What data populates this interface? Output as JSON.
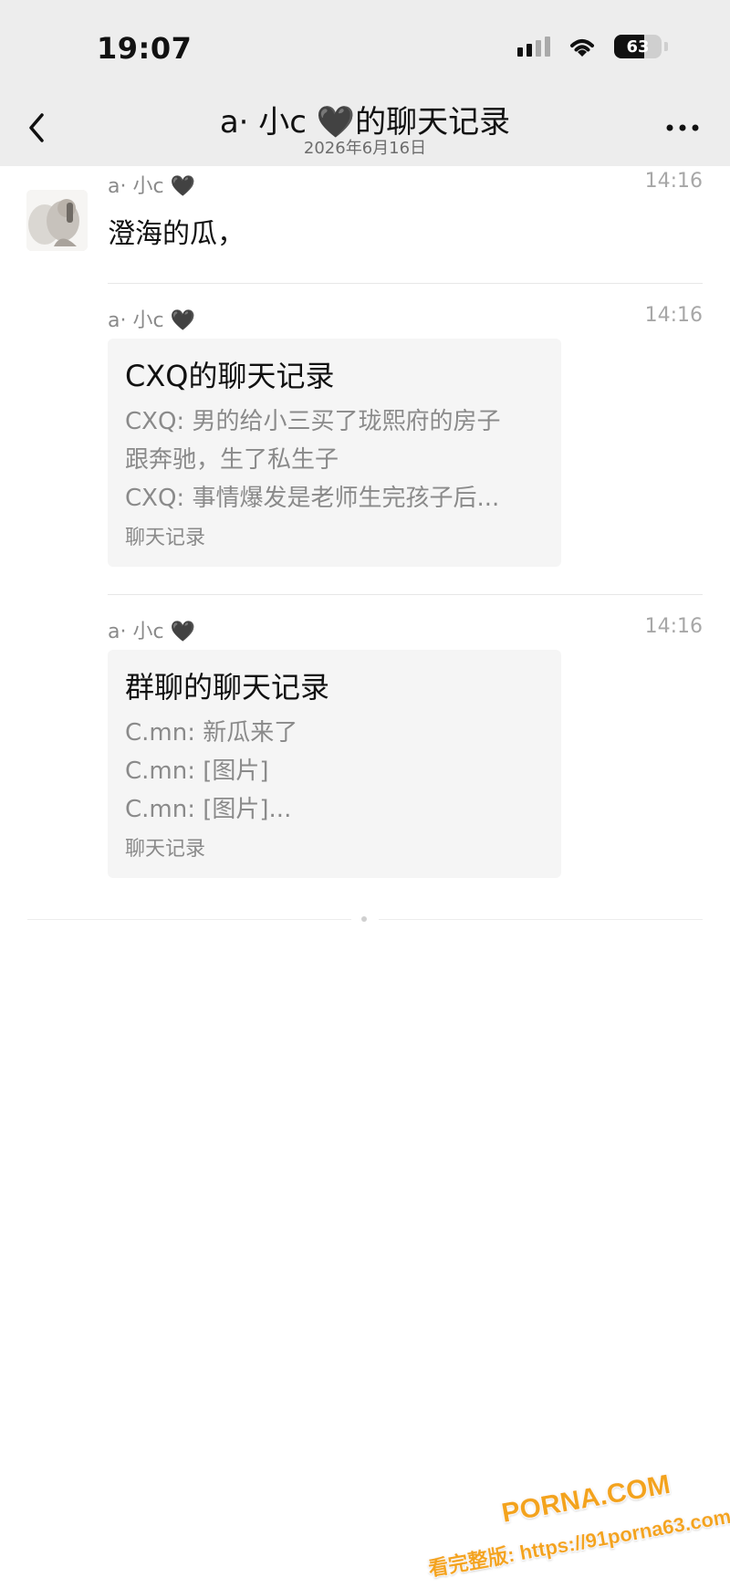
{
  "status_bar": {
    "time": "19:07",
    "battery": "63",
    "battery_level": 0.63
  },
  "nav": {
    "title": "a· 小c 🖤的聊天记录",
    "subtitle": "2026年6月16日"
  },
  "messages": [
    {
      "sender": "a· 小c 🖤",
      "time": "14:16",
      "text": "澄海的瓜，"
    },
    {
      "sender": "a· 小c 🖤",
      "time": "14:16",
      "card": {
        "title": "CXQ的聊天记录",
        "lines": [
          "CXQ: 男的给小三买了珑熙府的房子",
          "跟奔驰，生了私生子",
          "CXQ: 事情爆发是老师生完孩子后..."
        ],
        "footer": "聊天记录"
      }
    },
    {
      "sender": "a· 小c 🖤",
      "time": "14:16",
      "card": {
        "title": "群聊的聊天记录",
        "lines": [
          "C.mn: 新瓜来了",
          "C.mn: [图片]",
          "C.mn: [图片]..."
        ],
        "footer": "聊天记录"
      }
    }
  ],
  "watermark": {
    "logo": "PORNA.COM",
    "text": "看完整版: https://91porna63.com"
  },
  "colors": {
    "top_bg": "#ededed",
    "card_bg": "#f5f5f5",
    "watermark": "#f3a31b"
  }
}
